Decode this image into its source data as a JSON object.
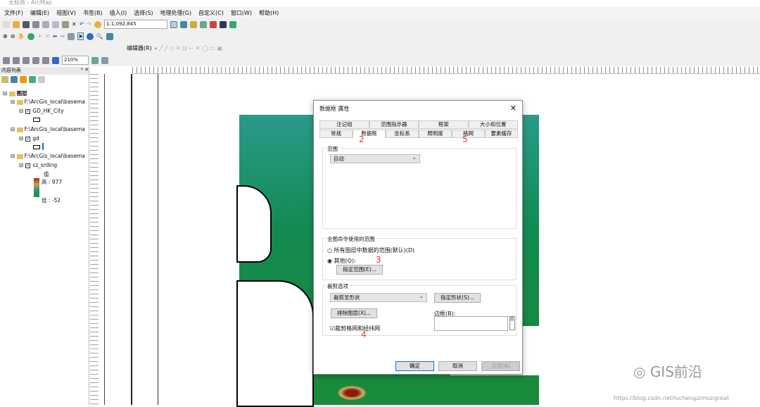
{
  "app": {
    "title": "无标题 - ArcMap"
  },
  "menu": [
    "文件(F)",
    "编辑(E)",
    "视图(V)",
    "书签(B)",
    "插入(I)",
    "选择(S)",
    "地理处理(G)",
    "自定义(C)",
    "窗口(W)",
    "帮助(H)"
  ],
  "toolbar": {
    "scale": "1:1,092,845",
    "editor": "编辑器(R)",
    "zoom": "210%"
  },
  "toc": {
    "title": "内容列表",
    "root": "图层",
    "groups": [
      {
        "path": "F:\\ArcGis_local\\basema",
        "layer": "GD_HK_City"
      },
      {
        "path": "F:\\ArcGis_local\\basema",
        "layer": "gd"
      },
      {
        "path": "F:\\ArcGis_local\\basema",
        "layer": "sz_srding"
      }
    ],
    "legend": {
      "title": "值",
      "high": "高 : 977",
      "low": "低 : -52"
    }
  },
  "dialog": {
    "title": "数据框 属性",
    "tabs_row1": [
      "注记组",
      "范围指示器",
      "框架",
      "大小和位置"
    ],
    "tabs_row2": [
      "常规",
      "数据框",
      "坐标系",
      "照明度",
      "格网",
      "要素缓存"
    ],
    "extent_label": "范围",
    "extent_value": "自动",
    "full_extent_label": "全图命令使用的范围",
    "radio_all": "所有图层中数据的范围(默认)(D)",
    "radio_other": "其他(O):",
    "specify_extent": "指定范围(E)...",
    "clip_label": "裁剪选项",
    "clip_value": "裁剪至形状",
    "specify_shape": "指定形状(S)...",
    "exclude_layers": "排除图层(X)...",
    "border_label": "边框(B):",
    "clip_grids": "裁剪格网和经纬网",
    "ok": "确定",
    "cancel": "取消",
    "apply": "应用(A)"
  },
  "annotations": [
    "2",
    "3",
    "4",
    "5"
  ],
  "watermark": {
    "brand": "GIS前沿",
    "url": "https://blog.csdn.net/luchengzimozigreat"
  },
  "colors": {
    "accent": "#0078d7",
    "terrain_green": "#138a50",
    "terrain_red": "#8b1a10"
  }
}
